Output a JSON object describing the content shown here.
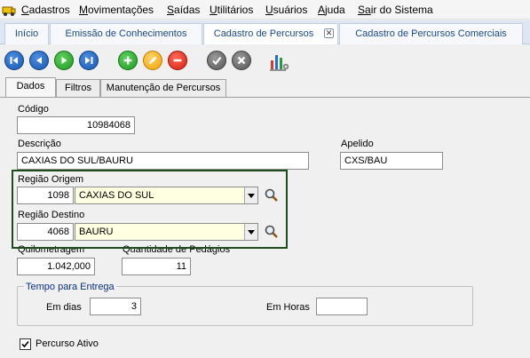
{
  "menu": {
    "items": [
      {
        "first": "C",
        "rest": "adastros"
      },
      {
        "first": "M",
        "rest": "ovimentações"
      },
      {
        "first": "S",
        "rest": "aídas"
      },
      {
        "first": "U",
        "rest": "tilitários"
      },
      {
        "first": "U",
        "rest": "suários"
      },
      {
        "first": "A",
        "rest": "juda"
      },
      {
        "first": "Sa",
        "rest": "ir do Sistema"
      }
    ]
  },
  "doc_tabs": [
    {
      "label": "Início"
    },
    {
      "label": "Emissão de Conhecimentos"
    },
    {
      "label": "Cadastro de Percursos",
      "close": "✕"
    },
    {
      "label": "Cadastro de Percursos Comerciais"
    }
  ],
  "toolbar": {
    "icons": [
      "first-record",
      "previous-record",
      "next-record",
      "last-record",
      "add",
      "edit",
      "delete",
      "confirm",
      "cancel",
      "report-chart"
    ]
  },
  "form_tabs": [
    "Dados",
    "Filtros",
    "Manutenção de Percursos"
  ],
  "form": {
    "codigo_label": "Código",
    "codigo_value": "10984068",
    "descricao_label": "Descrição",
    "descricao_value": "CAXIAS DO SUL/BAURU",
    "apelido_label": "Apelido",
    "apelido_value": "CXS/BAU",
    "regiao_origem_label": "Região Origem",
    "regiao_origem_code": "1098",
    "regiao_origem_name": "CAXIAS DO SUL",
    "regiao_destino_label": "Região Destino",
    "regiao_destino_code": "4068",
    "regiao_destino_name": "BAURU",
    "quilometragem_label": "Quilometragem",
    "quilometragem_value": "1.042,000",
    "pedagios_label": "Quantidade de Pedágios",
    "pedagios_value": "11",
    "tempo_group_label": "Tempo para Entrega",
    "em_dias_label": "Em dias",
    "em_dias_value": "3",
    "em_horas_label": "Em Horas",
    "em_horas_value": "",
    "percurso_ativo_label": "Percurso Ativo",
    "percurso_ativo_checked": true
  },
  "colors": {
    "accent_blue": "#1555b0",
    "highlight_box": "#1d4d1d",
    "lookup_bg": "#ffffe1"
  }
}
